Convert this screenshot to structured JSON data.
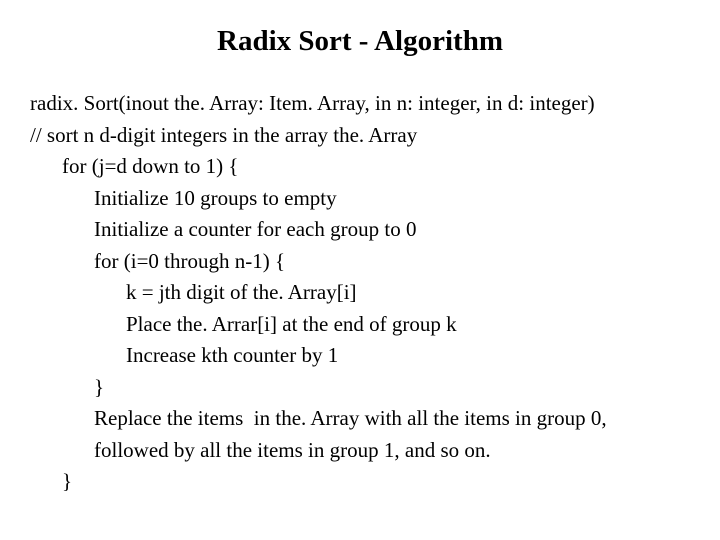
{
  "title": "Radix Sort - Algorithm",
  "lines": {
    "l1": "radix. Sort(inout the. Array: Item. Array, in n: integer, in d: integer)",
    "l2": "// sort n d-digit integers in the array the. Array",
    "l3": "for (j=d down to 1) {",
    "l4": "Initialize 10 groups to empty",
    "l5": "Initialize a counter for each group to 0",
    "l6": "for (i=0 through n-1) {",
    "l7": "k = jth digit of the. Array[i]",
    "l8": "Place the. Arrar[i] at the end of group k",
    "l9": "Increase kth counter by 1",
    "l10": "}",
    "l11": "Replace the items  in the. Array with all the items in group 0,",
    "l12": "followed by all the items in group 1, and so on.",
    "l13": "}"
  }
}
